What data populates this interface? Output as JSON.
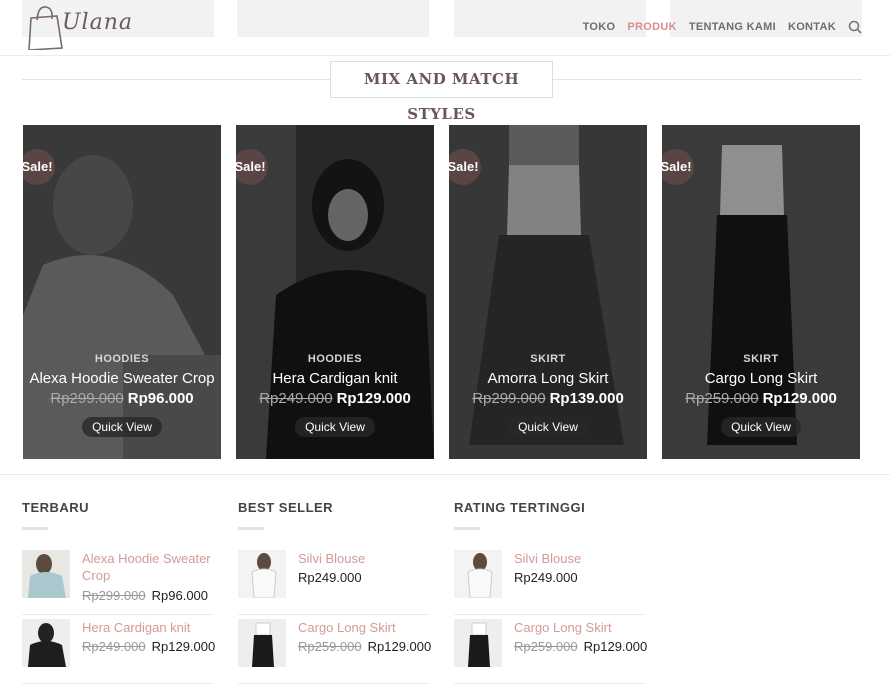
{
  "header": {
    "logo_text": "Ulana",
    "nav": [
      {
        "label": "TOKO",
        "active": false
      },
      {
        "label": "PRODUK",
        "active": true
      },
      {
        "label": "TENTANG KAMI",
        "active": false
      },
      {
        "label": "KONTAK",
        "active": false
      }
    ],
    "search_icon": "search-icon"
  },
  "section": {
    "title": "MIX AND MATCH STYLES"
  },
  "products": [
    {
      "badge": "Sale!",
      "category": "HOODIES",
      "name": "Alexa Hoodie Sweater Crop",
      "old_price": "Rp299.000",
      "price": "Rp96.000",
      "quick_view": "Quick View"
    },
    {
      "badge": "Sale!",
      "category": "HOODIES",
      "name": "Hera Cardigan knit",
      "old_price": "Rp249.000",
      "price": "Rp129.000",
      "quick_view": "Quick View"
    },
    {
      "badge": "Sale!",
      "category": "SKIRT",
      "name": "Amorra Long Skirt",
      "old_price": "Rp299.000",
      "price": "Rp139.000",
      "quick_view": "Quick View"
    },
    {
      "badge": "Sale!",
      "category": "SKIRT",
      "name": "Cargo Long Skirt",
      "old_price": "Rp259.000",
      "price": "Rp129.000",
      "quick_view": "Quick View"
    }
  ],
  "widgets": [
    {
      "title": "TERBARU",
      "items": [
        {
          "name": "Alexa Hoodie Sweater Crop",
          "old_price": "Rp299.000",
          "price": "Rp96.000"
        },
        {
          "name": "Hera Cardigan knit",
          "old_price": "Rp249.000",
          "price": "Rp129.000"
        }
      ]
    },
    {
      "title": "BEST SELLER",
      "items": [
        {
          "name": "Silvi Blouse",
          "old_price": "",
          "price": "Rp249.000"
        },
        {
          "name": "Cargo Long Skirt",
          "old_price": "Rp259.000",
          "price": "Rp129.000"
        }
      ]
    },
    {
      "title": "RATING TERTINGGI",
      "items": [
        {
          "name": "Silvi Blouse",
          "old_price": "",
          "price": "Rp249.000"
        },
        {
          "name": "Cargo Long Skirt",
          "old_price": "Rp259.000",
          "price": "Rp129.000"
        }
      ]
    }
  ],
  "colors": {
    "accent": "#d98f8f",
    "sale_badge": "#5a4545",
    "title": "#6a5656"
  }
}
